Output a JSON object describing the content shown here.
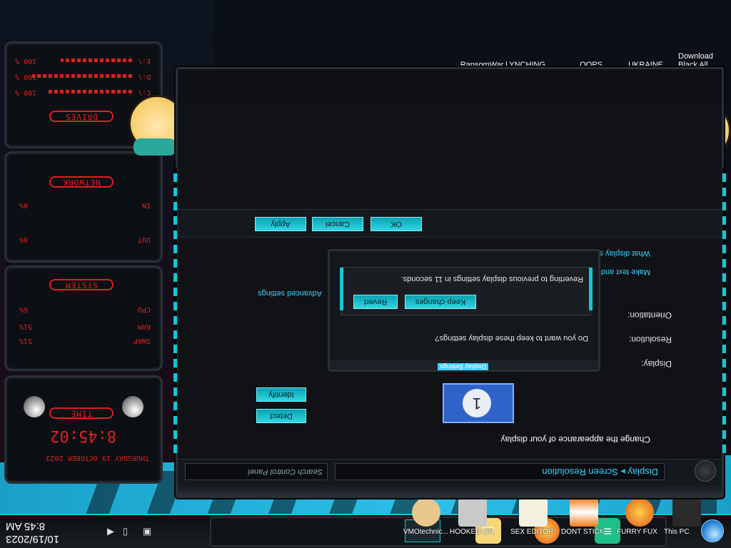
{
  "taskbar": {
    "clock_time": "8:45 AM",
    "clock_date": "10/19/2023"
  },
  "desktop_icons": [
    {
      "label": "This PC"
    },
    {
      "label": "FURRY FUX"
    },
    {
      "label": "DONT STICK"
    },
    {
      "label": "SEX EDITOR"
    },
    {
      "label": "HOOKED ON"
    },
    {
      "label": "VMOtechnic..."
    }
  ],
  "top_links": [
    {
      "label": "Download Black All..."
    },
    {
      "label": "UKRAINE"
    },
    {
      "label": "OOPS"
    },
    {
      "label": "LYNCHING"
    },
    {
      "label": "RansomWar..."
    }
  ],
  "window": {
    "breadcrumb": [
      "Display",
      "Screen Resolution"
    ],
    "search_placeholder": "Search Control Panel",
    "heading": "Change the appearance of your display",
    "monitor_number": "1",
    "detect_label": "Detect",
    "identify_label": "Identify",
    "display_label": "Display:",
    "resolution_label": "Resolution:",
    "orientation_label": "Orientation:",
    "advanced_link": "Advanced settings",
    "larger_link": "Make text and other items larger or smaller",
    "which_link": "What display settings should I choose?",
    "ok_label": "OK",
    "cancel_label": "Cancel",
    "apply_label": "Apply"
  },
  "dialog": {
    "title": "Display Settings",
    "question": "Do you want to keep these display settings?",
    "keep_label": "Keep changes",
    "revert_label": "Revert",
    "countdown": "Reverting to previous display settings in 11 seconds."
  },
  "gadgets": {
    "time_title": "TIME",
    "time_value": "8:45:02",
    "date_value": "THURSDAY 19 OCTOBER 2023",
    "system_title": "SYSTEM",
    "cpu_label": "CPU",
    "cpu_value": "6%",
    "ram_label": "RAM",
    "ram_value": "51%",
    "swap_label": "SWAP",
    "swap_value": "51%",
    "network_title": "NETWORK",
    "in_label": "IN",
    "in_value": "0%",
    "out_label": "OUT",
    "out_value": "0%",
    "drives_title": "DRIVES",
    "drives": [
      {
        "letter": "C:\\",
        "value": "100 %"
      },
      {
        "letter": "D:\\",
        "value": "100 %"
      },
      {
        "letter": "E:\\",
        "value": "100 %"
      }
    ]
  }
}
